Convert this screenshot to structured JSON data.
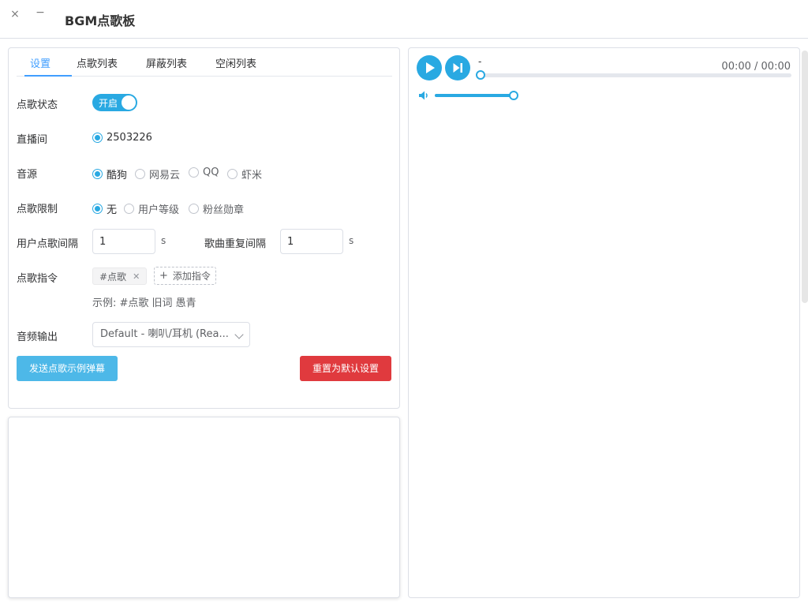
{
  "window": {
    "title": "BGM点歌板",
    "close_glyph": "×",
    "minimize_glyph": "−"
  },
  "tabs": [
    {
      "label": "设置",
      "active": true
    },
    {
      "label": "点歌列表",
      "active": false
    },
    {
      "label": "屏蔽列表",
      "active": false
    },
    {
      "label": "空闲列表",
      "active": false
    }
  ],
  "settings": {
    "status_label": "点歌状态",
    "status_switch_text": "开启",
    "status_on": true,
    "room_label": "直播间",
    "room_option": "2503226",
    "source_label": "音源",
    "source_options": [
      "酷狗",
      "网易云",
      "QQ",
      "虾米"
    ],
    "source_selected": "酷狗",
    "limit_label": "点歌限制",
    "limit_options": [
      "无",
      "用户等级",
      "粉丝勋章"
    ],
    "limit_selected": "无",
    "user_interval_label": "用户点歌间隔",
    "user_interval_value": "1",
    "user_interval_unit": "s",
    "repeat_interval_label": "歌曲重复间隔",
    "repeat_interval_value": "1",
    "repeat_interval_unit": "s",
    "command_label": "点歌指令",
    "command_tag": "#点歌",
    "add_command_label": "添加指令",
    "example_text": "示例: #点歌 旧词 愚青",
    "audio_output_label": "音频输出",
    "audio_output_value": "Default - 喇叭/耳机 (Rea...",
    "send_example_button": "发送点歌示例弹幕",
    "reset_button": "重置为默认设置"
  },
  "player": {
    "track_title": "-",
    "time": "00:00 / 00:00",
    "progress": 0,
    "volume": 1.0
  },
  "colors": {
    "accent": "#29a9e2",
    "tab_active": "#409eff",
    "danger": "#e03a3e",
    "send_button": "#4db8e8"
  },
  "icons": {
    "play": "play-icon",
    "next": "skip-next-icon",
    "volume": "volume-icon"
  }
}
